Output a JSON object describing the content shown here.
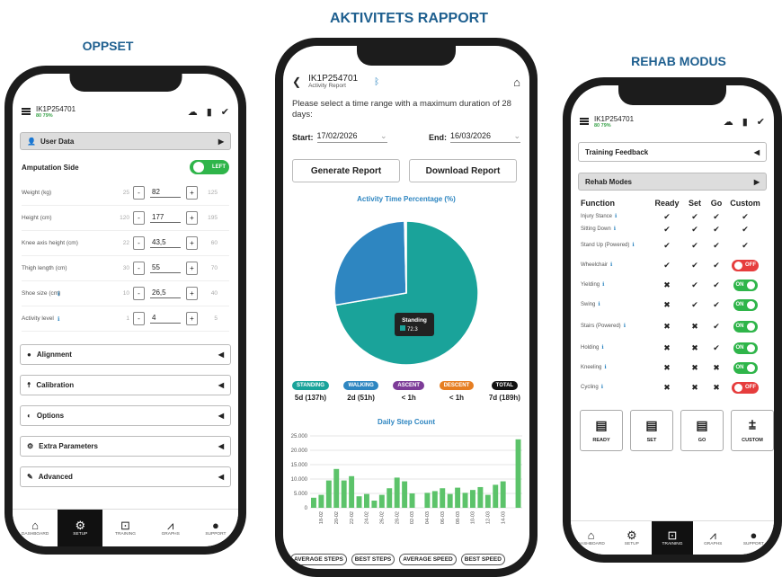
{
  "titles": {
    "left": "OPPSET",
    "center": "AKTIVITETS RAPPORT",
    "right": "REHAB MODUS"
  },
  "common": {
    "device_id": "IK1P254701",
    "battery": "80 79%",
    "nav": [
      "DASHBOARD",
      "SETUP",
      "TRAINING",
      "GRAPHS",
      "SUPPORT"
    ]
  },
  "setup": {
    "user_data": "User Data",
    "amputation_side": "Amputation Side",
    "side_toggle": "LEFT",
    "fields": [
      {
        "label": "Weight (kg)",
        "min": "25",
        "value": "82",
        "max": "125"
      },
      {
        "label": "Height (cm)",
        "min": "120",
        "value": "177",
        "max": "195"
      },
      {
        "label": "Knee axis height (cm)",
        "min": "22",
        "value": "43,5",
        "max": "60"
      },
      {
        "label": "Thigh length (cm)",
        "min": "30",
        "value": "55",
        "max": "70"
      },
      {
        "label": "Shoe size (cm)",
        "min": "10",
        "value": "26,5",
        "max": "40"
      },
      {
        "label": "Activity level",
        "min": "1",
        "value": "4",
        "max": "5"
      }
    ],
    "sections": [
      "Alignment",
      "Calibration",
      "Options",
      "Extra Parameters",
      "Advanced"
    ]
  },
  "report": {
    "device_sub": "Activity Report",
    "prompt": "Please select a time range with a maximum duration of 28 days:",
    "start_label": "Start:",
    "start_value": "17/02/2026",
    "end_label": "End:",
    "end_value": "16/03/2026",
    "generate": "Generate Report",
    "download": "Download Report",
    "pie_title": "Activity Time Percentage (%)",
    "pie_tooltip_label": "Standing",
    "pie_tooltip_value": "72.3",
    "cats": [
      {
        "name": "STANDING",
        "value": "5d (137h)",
        "color": "#1aa39a"
      },
      {
        "name": "WALKING",
        "value": "2d (51h)",
        "color": "#2e86c1"
      },
      {
        "name": "ASCENT",
        "value": "< 1h",
        "color": "#7d3c98"
      },
      {
        "name": "DESCENT",
        "value": "< 1h",
        "color": "#e67e22"
      },
      {
        "name": "TOTAL",
        "value": "7d (189h)",
        "color": "#111111"
      }
    ],
    "step_title": "Daily Step Count",
    "pills": [
      "AVERAGE STEPS",
      "BEST STEPS",
      "AVERAGE SPEED",
      "BEST SPEED"
    ]
  },
  "rehab": {
    "training_feedback": "Training Feedback",
    "rehab_modes": "Rehab Modes",
    "headers": [
      "Function",
      "Ready",
      "Set",
      "Go",
      "Custom"
    ],
    "rows": [
      {
        "name": "Injury Stance",
        "r": "✔",
        "s": "✔",
        "g": "✔",
        "c": "✔"
      },
      {
        "name": "Sitting Down",
        "r": "✔",
        "s": "✔",
        "g": "✔",
        "c": "✔"
      },
      {
        "name": "Stand Up (Powered)",
        "r": "✔",
        "s": "✔",
        "g": "✔",
        "c": "✔"
      },
      {
        "name": "Wheelchair",
        "r": "✔",
        "s": "✔",
        "g": "✔",
        "c": "OFF"
      },
      {
        "name": "Yielding",
        "r": "✖",
        "s": "✔",
        "g": "✔",
        "c": "ON"
      },
      {
        "name": "Swing",
        "r": "✖",
        "s": "✔",
        "g": "✔",
        "c": "ON"
      },
      {
        "name": "Stairs (Powered)",
        "r": "✖",
        "s": "✖",
        "g": "✔",
        "c": "ON"
      },
      {
        "name": "Holding",
        "r": "✖",
        "s": "✖",
        "g": "✔",
        "c": "ON"
      },
      {
        "name": "Kneeling",
        "r": "✖",
        "s": "✖",
        "g": "✖",
        "c": "ON"
      },
      {
        "name": "Cycling",
        "r": "✖",
        "s": "✖",
        "g": "✖",
        "c": "OFF"
      }
    ],
    "modes": [
      "READY",
      "SET",
      "GO",
      "CUSTOM"
    ]
  },
  "colors": {
    "title": "#1e5f8f",
    "on": "#2fb54a",
    "off": "#e63d3d",
    "standing": "#1aa39a",
    "walking": "#2e86c1",
    "steps": "#5cc36a"
  },
  "chart_data": [
    {
      "type": "pie",
      "title": "Activity Time Percentage (%)",
      "categories": [
        "Standing",
        "Walking",
        "Ascent",
        "Descent"
      ],
      "values": [
        72.3,
        27.3,
        0.2,
        0.2
      ]
    },
    {
      "type": "bar",
      "title": "Daily Step Count",
      "ylim": [
        0,
        25000
      ],
      "yticks": [
        "25.000",
        "20.000",
        "15.000",
        "10.000",
        "5.000",
        "0"
      ],
      "categories": [
        "17-02",
        "18-02",
        "19-02",
        "20-02",
        "21-02",
        "22-02",
        "23-02",
        "24-02",
        "25-02",
        "26-02",
        "27-02",
        "28-02",
        "01-03",
        "02-03",
        "03-03",
        "04-03",
        "05-03",
        "06-03",
        "07-03",
        "08-03",
        "09-03",
        "10-03",
        "11-03",
        "12-03",
        "13-03",
        "14-03",
        "15-03",
        "16-03"
      ],
      "xtick_labels": [
        "18-02",
        "20-02",
        "22-02",
        "24-02",
        "26-02",
        "28-02",
        "02-03",
        "04-03",
        "06-03",
        "08-03",
        "10-03",
        "12-03",
        "14-03"
      ],
      "values": [
        3500,
        4500,
        9500,
        13500,
        9500,
        11000,
        4000,
        4800,
        2500,
        4500,
        6800,
        10500,
        9200,
        5000,
        0,
        5200,
        5800,
        6800,
        4800,
        7000,
        5200,
        6200,
        7200,
        4500,
        8000,
        9200,
        0,
        23800
      ]
    }
  ]
}
